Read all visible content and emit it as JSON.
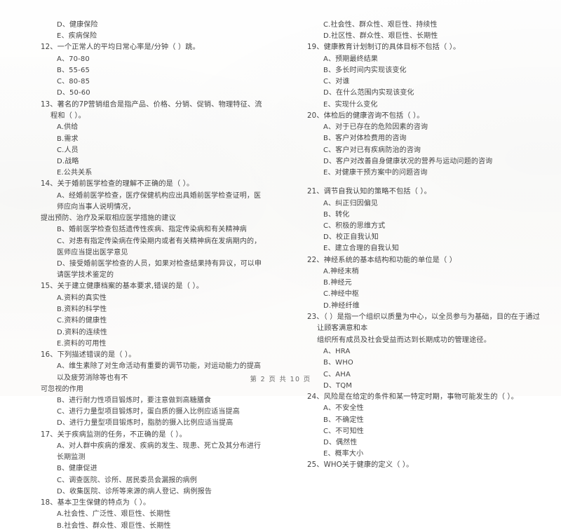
{
  "document": {
    "type": "scanned-exam-paper",
    "footer": "第 2 页 共 10 页",
    "ink_color": "#434343",
    "paper_color": "#fdfdfc"
  },
  "left_column": [
    {
      "kind": "option",
      "text": "D、健康保险"
    },
    {
      "kind": "option",
      "text": "E、疾病保险"
    },
    {
      "kind": "stem",
      "text": "12、一个正常人的平均日常心率是/分钟（    ）跳。"
    },
    {
      "kind": "option",
      "text": "A、70-80"
    },
    {
      "kind": "option",
      "text": "B、55-65"
    },
    {
      "kind": "option",
      "text": "C、80-85"
    },
    {
      "kind": "option",
      "text": "D、50-60"
    },
    {
      "kind": "stem",
      "text": "13、著名的7P营销组合是指产品、价格、分销、促销、物理特征、流程和（    ）。"
    },
    {
      "kind": "option",
      "text": "A.供给"
    },
    {
      "kind": "option",
      "text": "B.需求"
    },
    {
      "kind": "option",
      "text": "C.人员"
    },
    {
      "kind": "option",
      "text": "D.战略"
    },
    {
      "kind": "option",
      "text": "E.公共关系"
    },
    {
      "kind": "stem",
      "text": "14、关于婚前医学检查的理解不正确的是（    ）。"
    },
    {
      "kind": "option",
      "text": "A、经婚前医学检查，医疗保健机构应出具婚前医学检查证明，医师应向当事人说明情况，"
    },
    {
      "kind": "option-cont",
      "text": "提出预防、治疗及采取相应医学措施的建议"
    },
    {
      "kind": "option",
      "text": "B、婚前医学检查包括遗传性疾病、指定传染病和有关精神病"
    },
    {
      "kind": "option",
      "text": "C、对患有指定传染病在传染期内或者有关精神病在发病期内的，医师应当提出医学意见"
    },
    {
      "kind": "option",
      "text": "D、接受婚前医学检查的人员，如果对检查结果持有异议，可以申请医学技术鉴定的"
    },
    {
      "kind": "stem",
      "text": "15、关于建立健康档案的基本要求,错误的是（    ）。"
    },
    {
      "kind": "option",
      "text": "A.资料的真实性"
    },
    {
      "kind": "option",
      "text": "B.资料的科学性"
    },
    {
      "kind": "option",
      "text": "C.资料的健康性"
    },
    {
      "kind": "option",
      "text": "D.资料的连续性"
    },
    {
      "kind": "option",
      "text": "E.资料的可用性"
    },
    {
      "kind": "stem",
      "text": "16、下列描述错误的是（    ）。"
    },
    {
      "kind": "option",
      "text": "A、维生素除了对生命活动有重要的调节功能，对运动能力的提高以及疲劳消除等也有不"
    },
    {
      "kind": "option-cont",
      "text": "可忽视的作用"
    },
    {
      "kind": "option",
      "text": "B、进行耐力性项目锻炼时，要注意做到高糖膳食"
    },
    {
      "kind": "option",
      "text": "C、进行力量型项目锻炼时，蛋白质的摄入比例应适当提高"
    },
    {
      "kind": "option",
      "text": "D、进行力量型项目锻炼时，脂肪的摄入比例应适当提高"
    },
    {
      "kind": "stem",
      "text": "17、关于疾病监测的任务，不正确的是（    ）。"
    },
    {
      "kind": "option",
      "text": "A、对人群中疾病的爆发、疾病的发生、现患、死亡及其分布进行长期监测"
    },
    {
      "kind": "option",
      "text": "B、健康促进"
    },
    {
      "kind": "option",
      "text": "C、调查医院、诊所、居民委员会漏报的病例"
    },
    {
      "kind": "option",
      "text": "D、收集医院、诊所等来源的病人登记、病例报告"
    },
    {
      "kind": "stem",
      "text": "18、基本卫生保健的特点为（    ）。"
    },
    {
      "kind": "option",
      "text": "A.社会性、广泛性、艰巨性、长期性"
    },
    {
      "kind": "option",
      "text": "B.社会性、群众性、艰巨性、长期性"
    }
  ],
  "right_column": [
    {
      "kind": "option",
      "text": "C.社会性、群众性、艰巨性、持续性"
    },
    {
      "kind": "option",
      "text": "D.社区性、群众性、艰巨性、长期性"
    },
    {
      "kind": "stem",
      "text": "19、健康教育计划制订的具体目标不包括（    ）。"
    },
    {
      "kind": "option",
      "text": "A、预期最终结果"
    },
    {
      "kind": "option",
      "text": "B、多长时间内实现该变化"
    },
    {
      "kind": "option",
      "text": "C、对谁"
    },
    {
      "kind": "option",
      "text": "D、在什么范围内实现该变化"
    },
    {
      "kind": "option",
      "text": "E、实现什么变化"
    },
    {
      "kind": "stem",
      "text": "20、体检后的健康咨询不包括（    ）。"
    },
    {
      "kind": "option",
      "text": "A、对于已存在的危险因素的咨询"
    },
    {
      "kind": "option",
      "text": "B、客户对体检费用的咨询"
    },
    {
      "kind": "option",
      "text": "C、客户对已有疾病防治的咨询"
    },
    {
      "kind": "option",
      "text": "D、客户对改善自身健康状况的营养与运动问题的咨询"
    },
    {
      "kind": "option",
      "text": "E、对健康干预方案中的问题咨询"
    },
    {
      "kind": "spacer",
      "text": ""
    },
    {
      "kind": "stem",
      "text": "21、调节自我认知的策略不包括（    ）。"
    },
    {
      "kind": "option",
      "text": "A、纠正归因偏见"
    },
    {
      "kind": "option",
      "text": "B、转化"
    },
    {
      "kind": "option",
      "text": "C、积极的思维方式"
    },
    {
      "kind": "option",
      "text": "D、校正自我认知"
    },
    {
      "kind": "option",
      "text": "E、建立合理的自我认知"
    },
    {
      "kind": "stem",
      "text": "22、神经系统的基本结构和功能的单位是（    ）"
    },
    {
      "kind": "option",
      "text": "A.神经末梢"
    },
    {
      "kind": "option",
      "text": "B.神经元"
    },
    {
      "kind": "option",
      "text": "C.神经中枢"
    },
    {
      "kind": "option",
      "text": "D.神经纤维"
    },
    {
      "kind": "stem",
      "text": "23、（    ）是指一个组织以质量为中心，以全员参与为基础，目的在于通过让顾客满意和本"
    },
    {
      "kind": "stem-cont",
      "text": "组织所有成员及社会受益而达到长期成功的管理途径。"
    },
    {
      "kind": "option",
      "text": "A、HRA"
    },
    {
      "kind": "option",
      "text": "B、WHO"
    },
    {
      "kind": "option",
      "text": "C、AHA"
    },
    {
      "kind": "option",
      "text": "D、TQM"
    },
    {
      "kind": "stem",
      "text": "24、风险是在给定的条件和某一特定时期，事物可能发生的（    ）。"
    },
    {
      "kind": "option",
      "text": "A、不安全性"
    },
    {
      "kind": "option",
      "text": "B、不确定性"
    },
    {
      "kind": "option",
      "text": "C、不可知性"
    },
    {
      "kind": "option",
      "text": "D、偶然性"
    },
    {
      "kind": "option",
      "text": "E、概率大小"
    },
    {
      "kind": "stem",
      "text": "25、WHO关于健康的定义（    ）。"
    }
  ]
}
